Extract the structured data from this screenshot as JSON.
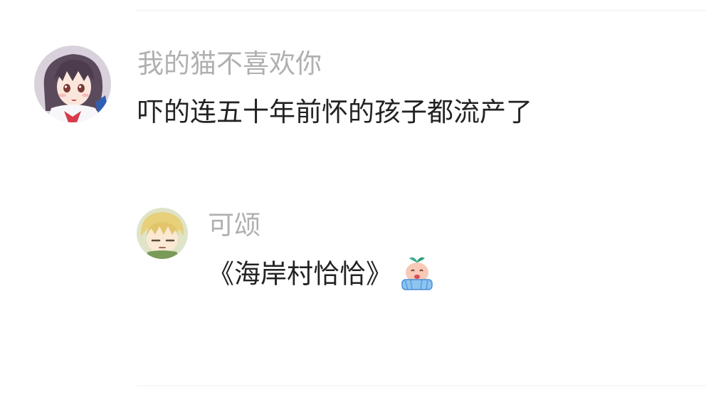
{
  "comments": [
    {
      "username": "我的猫不喜欢你",
      "text": "吓的连五十年前怀的孩子都流产了",
      "avatar_icon": "anime-girl-avatar"
    }
  ],
  "reply": {
    "username": "可颂",
    "text": "《海岸村恰恰》",
    "avatar_icon": "anime-boy-avatar",
    "emoji_icon": "crying-emoji"
  },
  "colors": {
    "username": "#b0b0b0",
    "text": "#222222",
    "divider": "#eeeeee"
  }
}
